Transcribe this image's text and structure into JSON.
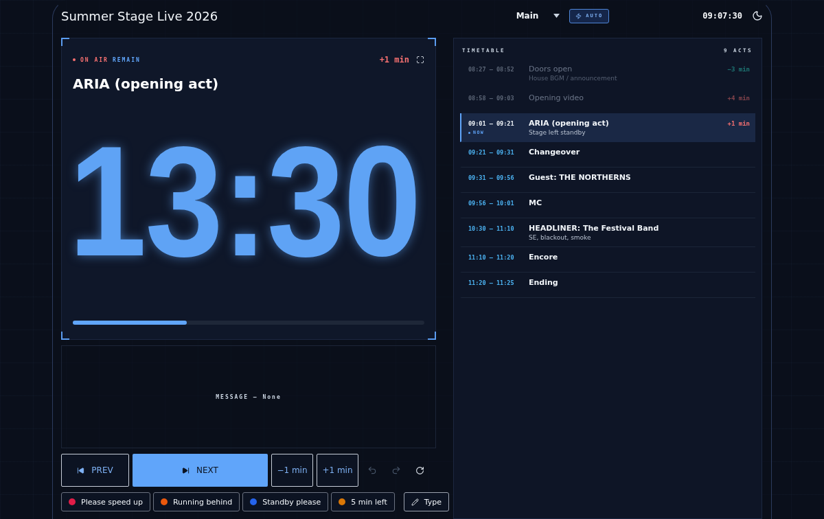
{
  "header": {
    "title": "Summer Stage Live 2026",
    "stage_select": {
      "value": "Main"
    },
    "auto_button": {
      "label": "AUTO"
    },
    "clock": "09:07:30"
  },
  "timer": {
    "on_air": "ON AIR",
    "mode": "REMAIN",
    "offset": "+1 min",
    "act_title": "ARIA (opening act)",
    "time": "13:30",
    "progress": {
      "level": 0.325
    }
  },
  "message": {
    "label": "MESSAGE – None"
  },
  "controls": [
    {
      "label": "PREV",
      "kind": "prev"
    },
    {
      "label": "NEXT",
      "kind": "next"
    },
    {
      "label": "−1 min",
      "kind": "adjust"
    },
    {
      "label": "+1 min",
      "kind": "adjust"
    }
  ],
  "quick_messages": [
    {
      "label": "Please speed up",
      "color": "#e11d48"
    },
    {
      "label": "Running behind",
      "color": "#ea580c"
    },
    {
      "label": "Standby please",
      "color": "#2563eb"
    },
    {
      "label": "5 min left",
      "color": "#d97706"
    }
  ],
  "type_button": {
    "label": "Type"
  },
  "timetable": {
    "title": "TIMETABLE",
    "count": "9 ACTS",
    "rows": [
      {
        "time": "08:27 – 08:52",
        "title": "Doors open",
        "note": "House BGM / announcement",
        "delta": "−3 min",
        "late": false,
        "past": true,
        "selected": false
      },
      {
        "time": "08:58 – 09:03",
        "title": "Opening video",
        "delta": "+4 min",
        "late": true,
        "past": true,
        "selected": false
      },
      {
        "time": "09:01 – 09:21",
        "tag": "NOW",
        "title": "ARIA (opening act)",
        "note": "Stage left standby",
        "delta": "+1 min",
        "late": true,
        "past": false,
        "selected": true
      },
      {
        "time": "09:21 – 09:31",
        "title": "Changeover",
        "past": false,
        "selected": false
      },
      {
        "time": "09:31 – 09:56",
        "title": "Guest: THE NORTHERNS",
        "past": false,
        "selected": false
      },
      {
        "time": "09:56 – 10:01",
        "title": "MC",
        "past": false,
        "selected": false
      },
      {
        "time": "10:30 – 11:10",
        "title": "HEADLINER: The Festival Band",
        "note": "SE, blackout, smoke",
        "past": false,
        "selected": false
      },
      {
        "time": "11:10 – 11:20",
        "title": "Encore",
        "past": false,
        "selected": false
      },
      {
        "time": "11:20 – 11:25",
        "title": "Ending",
        "past": false,
        "selected": false
      }
    ]
  }
}
